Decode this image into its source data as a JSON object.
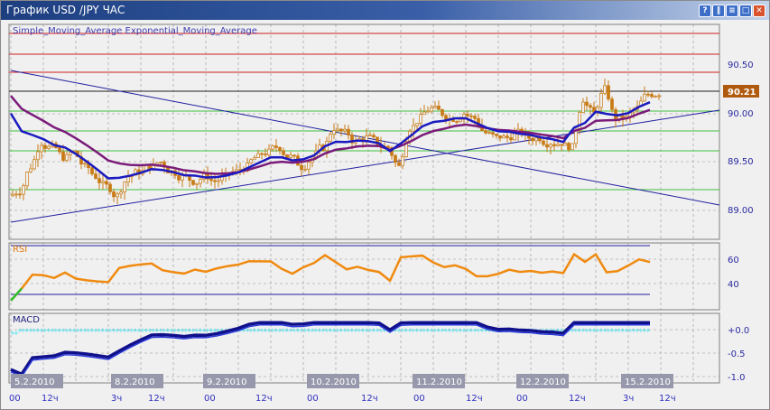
{
  "window": {
    "title": "График USD /JPY  ЧАС",
    "buttons": [
      {
        "name": "help-button",
        "glyph": "?"
      },
      {
        "name": "pause-button",
        "glyph": "‖"
      },
      {
        "name": "menu-button",
        "glyph": "≡"
      },
      {
        "name": "maximize-button",
        "glyph": "□"
      },
      {
        "name": "close-button",
        "glyph": "✕"
      }
    ]
  },
  "price_panel": {
    "legend": "Simple_Moving_Average Exponential_Moving_Average",
    "axis": [
      "90.50",
      "90.00",
      "89.50",
      "89.00"
    ],
    "current_price": "90.21"
  },
  "rsi_panel": {
    "legend": "RSI",
    "axis": [
      "60",
      "40"
    ]
  },
  "macd_panel": {
    "legend": "MACD",
    "axis": [
      "+0.0",
      "-0.5",
      "-1.0"
    ]
  },
  "dates": [
    "5.2.2010",
    "8.2.2010",
    "9.2.2010",
    "10.2.2010",
    "11.2.2010",
    "12.2.2010",
    "15.2.2010"
  ],
  "times": [
    "00",
    "12ч",
    "3ч",
    "12ч",
    "00",
    "12ч",
    "00",
    "12ч",
    "00",
    "12ч",
    "00",
    "12ч",
    "3ч",
    "12ч"
  ],
  "colors": {
    "candle": "#c87a14",
    "ema": "#1a1ac0",
    "sma": "#7a1a7a",
    "rsi": "#f08a10",
    "macd": "#10108a",
    "signal": "#30e0f0",
    "price_box": "#b05a10"
  },
  "chart_data": {
    "type": "candlestick",
    "symbol": "USD/JPY",
    "timeframe": "H1",
    "closes": [
      89.2,
      89.45,
      89.7,
      89.65,
      89.55,
      89.6,
      89.45,
      89.35,
      89.25,
      89.15,
      89.35,
      89.4,
      89.45,
      89.5,
      89.4,
      89.35,
      89.3,
      89.35,
      89.3,
      89.35,
      89.4,
      89.45,
      89.55,
      89.6,
      89.65,
      89.55,
      89.45,
      89.55,
      89.65,
      89.85,
      89.8,
      89.7,
      89.75,
      89.7,
      89.65,
      89.45,
      89.85,
      89.95,
      90.05,
      90.0,
      89.95,
      90.0,
      89.95,
      89.8,
      89.75,
      89.75,
      89.8,
      89.75,
      89.75,
      89.7,
      89.7,
      89.65,
      90.15,
      90.0,
      90.25,
      89.95,
      89.95,
      90.05,
      90.2,
      90.21
    ],
    "ylim": [
      88.85,
      90.75
    ]
  }
}
